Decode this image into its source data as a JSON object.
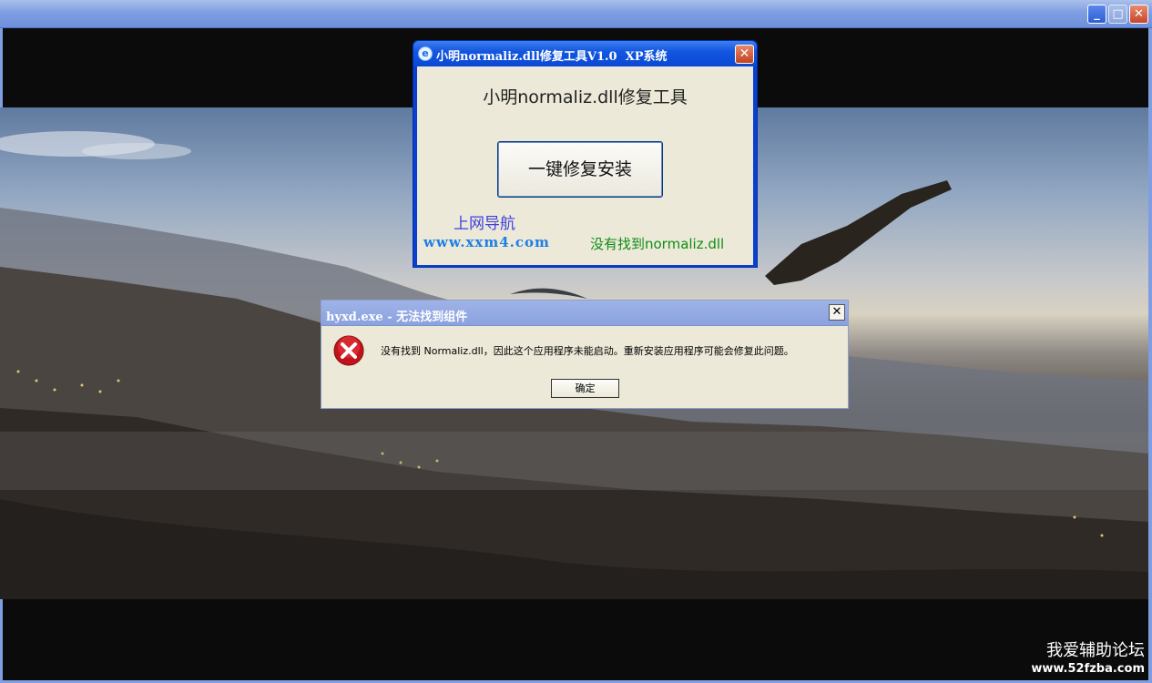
{
  "outer_window": {
    "controls": {
      "minimize": "_",
      "maximize": "□",
      "close": "✕"
    }
  },
  "tool_dialog": {
    "title": "小明normaliz.dll修复工具V1.0  XP系统",
    "close": "✕",
    "heading": "小明normaliz.dll修复工具",
    "repair_button": "一键修复安装",
    "nav_link": "上网导航",
    "site_url": "www.xxm4.com",
    "status": "没有找到normaliz.dll",
    "status_color": "#0f8d16"
  },
  "error_dialog": {
    "title": "hyxd.exe - 无法找到组件",
    "close": "✕",
    "message": "没有找到 Normaliz.dll，因此这个应用程序未能启动。重新安装应用程序可能会修复此问题。",
    "ok_button": "确定",
    "icon": "error-icon"
  },
  "watermark": {
    "line1": "我爱辅助论坛",
    "line2": "www.52fzba.com"
  }
}
